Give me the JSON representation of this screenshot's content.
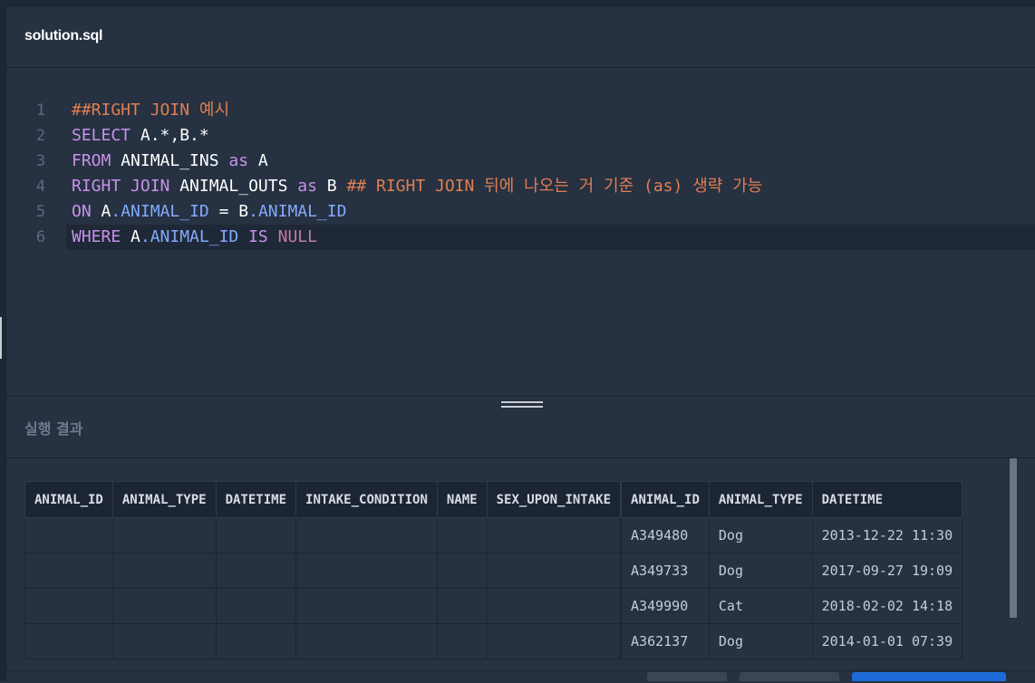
{
  "editor": {
    "filename": "solution.sql",
    "lines": [
      {
        "num": "1",
        "tokens": [
          [
            "##RIGHT JOIN 예시",
            "k-orange"
          ]
        ]
      },
      {
        "num": "2",
        "tokens": [
          [
            "SELECT",
            "k-purple"
          ],
          [
            " A.*,B.*",
            "k-white"
          ]
        ]
      },
      {
        "num": "3",
        "tokens": [
          [
            "FROM",
            "k-purple"
          ],
          [
            " ANIMAL_INS ",
            "k-white"
          ],
          [
            "as",
            "k-purple"
          ],
          [
            " A",
            "k-white"
          ]
        ]
      },
      {
        "num": "4",
        "tokens": [
          [
            "RIGHT JOIN",
            "k-purple"
          ],
          [
            " ANIMAL_OUTS ",
            "k-white"
          ],
          [
            "as",
            "k-purple"
          ],
          [
            " B ",
            "k-white"
          ],
          [
            "## RIGHT JOIN 뒤에 나오는 거 기준 (as) 생략 가능",
            "k-orange"
          ]
        ]
      },
      {
        "num": "5",
        "tokens": [
          [
            "ON",
            "k-purple"
          ],
          [
            " A",
            "k-white"
          ],
          [
            ".ANIMAL_ID",
            "k-blue"
          ],
          [
            " = B",
            "k-white"
          ],
          [
            ".ANIMAL_ID",
            "k-blue"
          ]
        ]
      },
      {
        "num": "6",
        "tokens": [
          [
            "WHERE",
            "k-purple"
          ],
          [
            " A",
            "k-white"
          ],
          [
            ".ANIMAL_ID",
            "k-blue"
          ],
          [
            " ",
            "k-white"
          ],
          [
            "IS",
            "k-purple"
          ],
          [
            " ",
            "k-white"
          ],
          [
            "NULL",
            "k-pink"
          ]
        ]
      }
    ]
  },
  "results": {
    "title": "실행 결과",
    "columns": [
      "ANIMAL_ID",
      "ANIMAL_TYPE",
      "DATETIME",
      "INTAKE_CONDITION",
      "NAME",
      "SEX_UPON_INTAKE",
      "ANIMAL_ID",
      "ANIMAL_TYPE",
      "DATETIME"
    ],
    "rows": [
      [
        "",
        "",
        "",
        "",
        "",
        "",
        "A349480",
        "Dog",
        "2013-12-22 11:30"
      ],
      [
        "",
        "",
        "",
        "",
        "",
        "",
        "A349733",
        "Dog",
        "2017-09-27 19:09"
      ],
      [
        "",
        "",
        "",
        "",
        "",
        "",
        "A349990",
        "Cat",
        "2018-02-02 14:18"
      ],
      [
        "",
        "",
        "",
        "",
        "",
        "",
        "A362137",
        "Dog",
        "2014-01-01 07:39"
      ]
    ]
  }
}
